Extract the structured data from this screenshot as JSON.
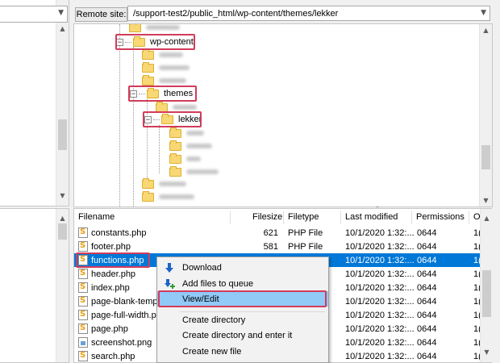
{
  "remote_site": {
    "label": "Remote site:",
    "path": "/support-test2/public_html/wp-content/themes/lekker"
  },
  "tree": {
    "wp_content": "wp-content",
    "themes": "themes",
    "lekker": "lekker"
  },
  "columns": {
    "filename": "Filename",
    "filesize": "Filesize",
    "filetype": "Filetype",
    "last_modified": "Last modified",
    "permissions": "Permissions",
    "owner": "O"
  },
  "files": [
    {
      "name": "constants.php",
      "size": "621",
      "type": "PHP File",
      "modified": "10/1/2020 1:32:...",
      "perms": "0644",
      "owner": "1(",
      "icon": "php-file-icon"
    },
    {
      "name": "footer.php",
      "size": "581",
      "type": "PHP File",
      "modified": "10/1/2020 1:32:...",
      "perms": "0644",
      "owner": "1(",
      "icon": "php-file-icon"
    },
    {
      "name": "functions.php",
      "size": "",
      "type": "",
      "modified": "10/1/2020 1:32:...",
      "perms": "0644",
      "owner": "1(",
      "icon": "php-file-icon"
    },
    {
      "name": "header.php",
      "size": "",
      "type": "",
      "modified": "10/1/2020 1:32:...",
      "perms": "0644",
      "owner": "1(",
      "icon": "php-file-icon"
    },
    {
      "name": "index.php",
      "size": "",
      "type": "",
      "modified": "10/1/2020 1:32:...",
      "perms": "0644",
      "owner": "1(",
      "icon": "php-file-icon"
    },
    {
      "name": "page-blank-temp",
      "size": "",
      "type": "",
      "modified": "10/1/2020 1:32:...",
      "perms": "0644",
      "owner": "1(",
      "icon": "php-file-icon"
    },
    {
      "name": "page-full-width.p",
      "size": "",
      "type": "",
      "modified": "10/1/2020 1:32:...",
      "perms": "0644",
      "owner": "1(",
      "icon": "php-file-icon"
    },
    {
      "name": "page.php",
      "size": "",
      "type": "",
      "modified": "10/1/2020 1:32:...",
      "perms": "0644",
      "owner": "1(",
      "icon": "php-file-icon"
    },
    {
      "name": "screenshot.png",
      "size": "",
      "type": "",
      "modified": "10/1/2020 1:32:...",
      "perms": "0644",
      "owner": "1(",
      "icon": "png-file-icon"
    },
    {
      "name": "search.php",
      "size": "",
      "type": "",
      "modified": "10/1/2020 1:32:...",
      "perms": "0644",
      "owner": "1(",
      "icon": "php-file-icon"
    }
  ],
  "context_menu": {
    "download": "Download",
    "add_to_queue": "Add files to queue",
    "view_edit": "View/Edit",
    "create_directory": "Create directory",
    "create_directory_enter": "Create directory and enter it",
    "create_new_file": "Create new file"
  },
  "colors": {
    "selection": "#0078d7",
    "highlight_box": "#d23c5a",
    "menu_hover": "#91c9f7"
  }
}
